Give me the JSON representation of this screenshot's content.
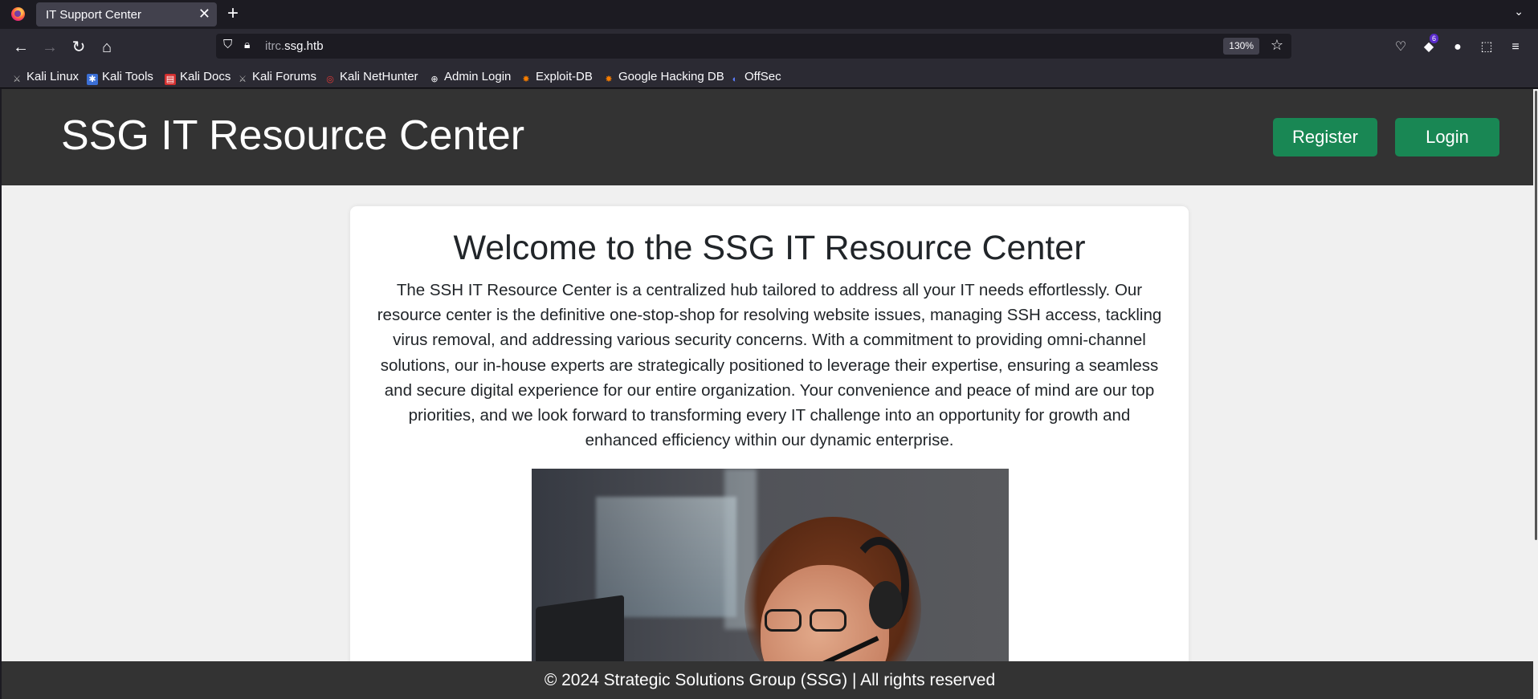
{
  "browser": {
    "tab_title": "IT Support Center",
    "url_prefix": "itrc.",
    "url_domain": "ssg.htb",
    "zoom": "130%",
    "extension_badge": "6",
    "bookmarks": [
      {
        "label": "Kali Linux",
        "icon": "kali-dragon-icon"
      },
      {
        "label": "Kali Tools",
        "icon": "kali-tools-icon"
      },
      {
        "label": "Kali Docs",
        "icon": "kali-docs-icon"
      },
      {
        "label": "Kali Forums",
        "icon": "kali-forums-icon"
      },
      {
        "label": "Kali NetHunter",
        "icon": "nethunter-icon"
      },
      {
        "label": "Admin Login",
        "icon": "globe-icon"
      },
      {
        "label": "Exploit-DB",
        "icon": "exploit-db-icon"
      },
      {
        "label": "Google Hacking DB",
        "icon": "ghdb-icon"
      },
      {
        "label": "OffSec",
        "icon": "offsec-icon"
      }
    ]
  },
  "site": {
    "title": "SSG IT Resource Center",
    "register_label": "Register",
    "login_label": "Login",
    "welcome_heading": "Welcome to the SSG IT Resource Center",
    "intro_text": "The SSH IT Resource Center is a centralized hub tailored to address all your IT needs effortlessly. Our resource center is the definitive one-stop-shop for resolving website issues, managing SSH access, tackling virus removal, and addressing various security concerns. With a commitment to providing omni-channel solutions, our in-house experts are strategically positioned to leverage their expertise, ensuring a seamless and secure digital experience for our entire organization. Your convenience and peace of mind are our top priorities, and we look forward to transforming every IT challenge into an opportunity for growth and enhanced efficiency within our dynamic enterprise.",
    "footer_text": "© 2024 Strategic Solutions Group (SSG) | All rights reserved",
    "button_color": "#198754",
    "header_color": "#333333"
  }
}
